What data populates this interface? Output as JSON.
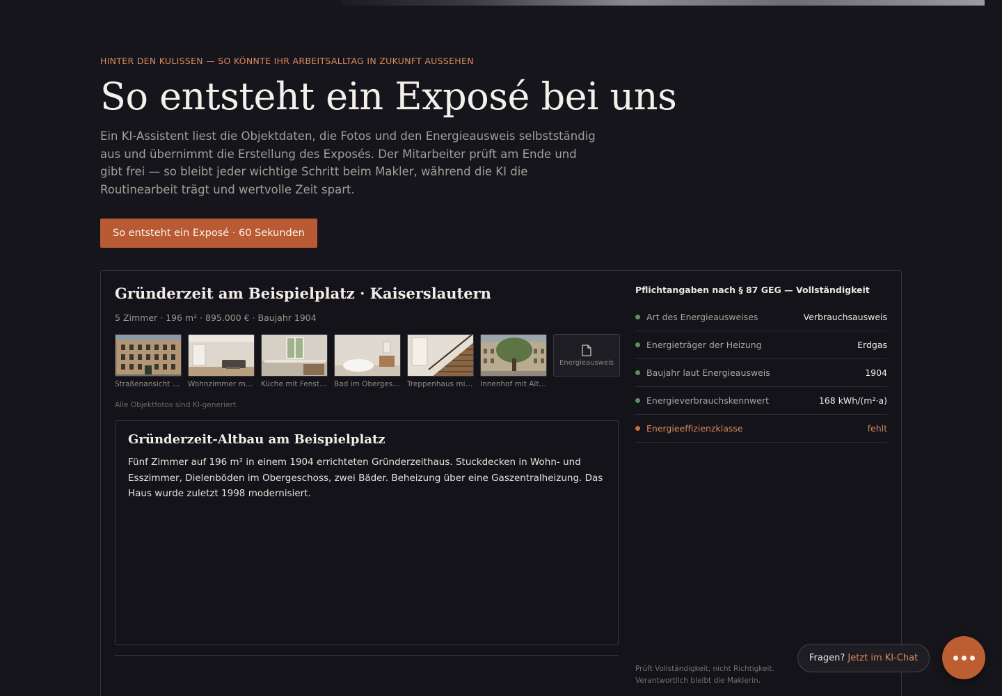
{
  "hero": {
    "eyebrow": "HINTER DEN KULISSEN — SO KÖNNTE IHR ARBEITSALLTAG IN ZUKUNFT AUSSEHEN",
    "title": "So entsteht ein Exposé bei uns",
    "description": "Ein KI-Assistent liest die Objektdaten, die Fotos und den Energieausweis selbstständig aus und übernimmt die Erstellung des Exposés. Der Mitarbeiter prüft am Ende und gibt frei — so bleibt jeder wichtige Schritt beim Makler, während die KI die Routinearbeit trägt und wertvolle Zeit spart.",
    "cta_label": "So entsteht ein Exposé · 60 Sekunden"
  },
  "listing": {
    "title": "Gründerzeit am Beispielplatz · Kaiserslautern",
    "meta": "5 Zimmer · 196 m² · 895.000 € · Baujahr 1904",
    "photos": [
      {
        "caption": "Straßenansicht der Gründerzeitfassade",
        "icon": "facade-photo"
      },
      {
        "caption": "Wohnzimmer mit Stuckdecke",
        "icon": "living-room-photo"
      },
      {
        "caption": "Küche mit Fenster zum Hof",
        "icon": "kitchen-photo"
      },
      {
        "caption": "Bad im Obergeschoss",
        "icon": "bathroom-photo"
      },
      {
        "caption": "Treppenhaus mit Holzgeländer",
        "icon": "staircase-photo"
      },
      {
        "caption": "Innenhof mit Altbaumbestand",
        "icon": "courtyard-photo"
      }
    ],
    "document_tile": "Energieausweis",
    "photo_note": "Alle Objektfotos sind KI-generiert."
  },
  "expose": {
    "title": "Gründerzeit-Altbau am Beispielplatz",
    "text": "Fünf Zimmer auf 196 m² in einem 1904 errichteten Gründerzeithaus. Stuckdecken in Wohn- und Esszimmer, Dielenböden im Obergeschoss, zwei Bäder. Beheizung über eine Gaszentralheizung. Das Haus wurde zuletzt 1998 modernisiert."
  },
  "geg": {
    "title": "Pflichtangaben nach § 87 GEG — Vollständigkeit",
    "rows": [
      {
        "label": "Art des Energieausweises",
        "value": "Verbrauchsausweis",
        "status": "ok"
      },
      {
        "label": "Energieträger der Heizung",
        "value": "Erdgas",
        "status": "ok"
      },
      {
        "label": "Baujahr laut Energieausweis",
        "value": "1904",
        "status": "ok"
      },
      {
        "label": "Energieverbrauchskennwert",
        "value": "168 kWh/(m²·a)",
        "status": "ok"
      },
      {
        "label": "Energieeffizienzklasse",
        "value": "fehlt",
        "status": "missing"
      }
    ],
    "footnote": "Prüft Vollständigkeit, nicht Richtigkeit. Verantwortlich bleibt die Maklerin."
  },
  "chat": {
    "prompt": "Fragen?",
    "link": "Jetzt im KI-Chat",
    "fab_icon": "more-dots-icon"
  },
  "colors": {
    "background": "#16151b",
    "accent": "#b85a33",
    "accent_text": "#d98a60",
    "ok": "#5e8e63"
  }
}
